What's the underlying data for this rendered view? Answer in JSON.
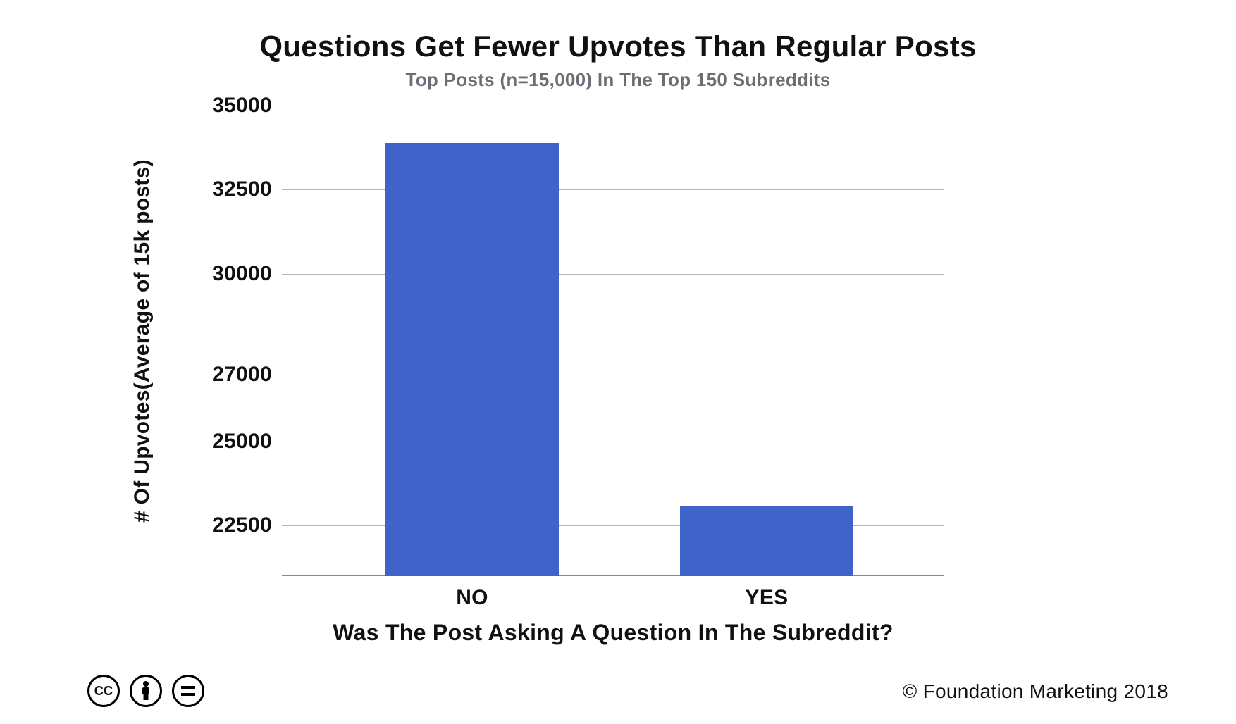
{
  "chart_data": {
    "type": "bar",
    "title": "Questions Get Fewer Upvotes Than Regular Posts",
    "subtitle": "Top Posts (n=15,000) In The Top 150 Subreddits",
    "xlabel": "Was The Post Asking A Question In The Subreddit?",
    "ylabel": "# Of Upvotes(Average of 15k posts)",
    "categories": [
      "NO",
      "YES"
    ],
    "values": [
      33900,
      23100
    ],
    "ylim": [
      21000,
      35000
    ],
    "yticks": [
      22500,
      25000,
      27000,
      30000,
      32500,
      35000
    ],
    "bar_color": "#3f63c9"
  },
  "footer": {
    "copyright": "© Foundation Marketing 2018"
  },
  "cc_badges": [
    "cc",
    "by",
    "nd"
  ]
}
